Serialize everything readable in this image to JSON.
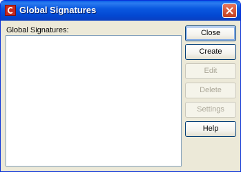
{
  "window": {
    "title": "Global Signatures",
    "app_icon": "app-c-icon",
    "close_icon": "close-x-icon"
  },
  "list": {
    "label": "Global Signatures:",
    "items": []
  },
  "buttons": {
    "close": {
      "label": "Close",
      "enabled": true,
      "default": true
    },
    "create": {
      "label": "Create",
      "enabled": true
    },
    "edit": {
      "label": "Edit",
      "enabled": false
    },
    "delete": {
      "label": "Delete",
      "enabled": false
    },
    "settings": {
      "label": "Settings",
      "enabled": false
    },
    "help": {
      "label": "Help",
      "enabled": true
    }
  },
  "colors": {
    "titlebar": "#0a58e0",
    "window_bg": "#ece9d8",
    "close_button": "#d85c3f",
    "disabled_text": "#aca899"
  }
}
